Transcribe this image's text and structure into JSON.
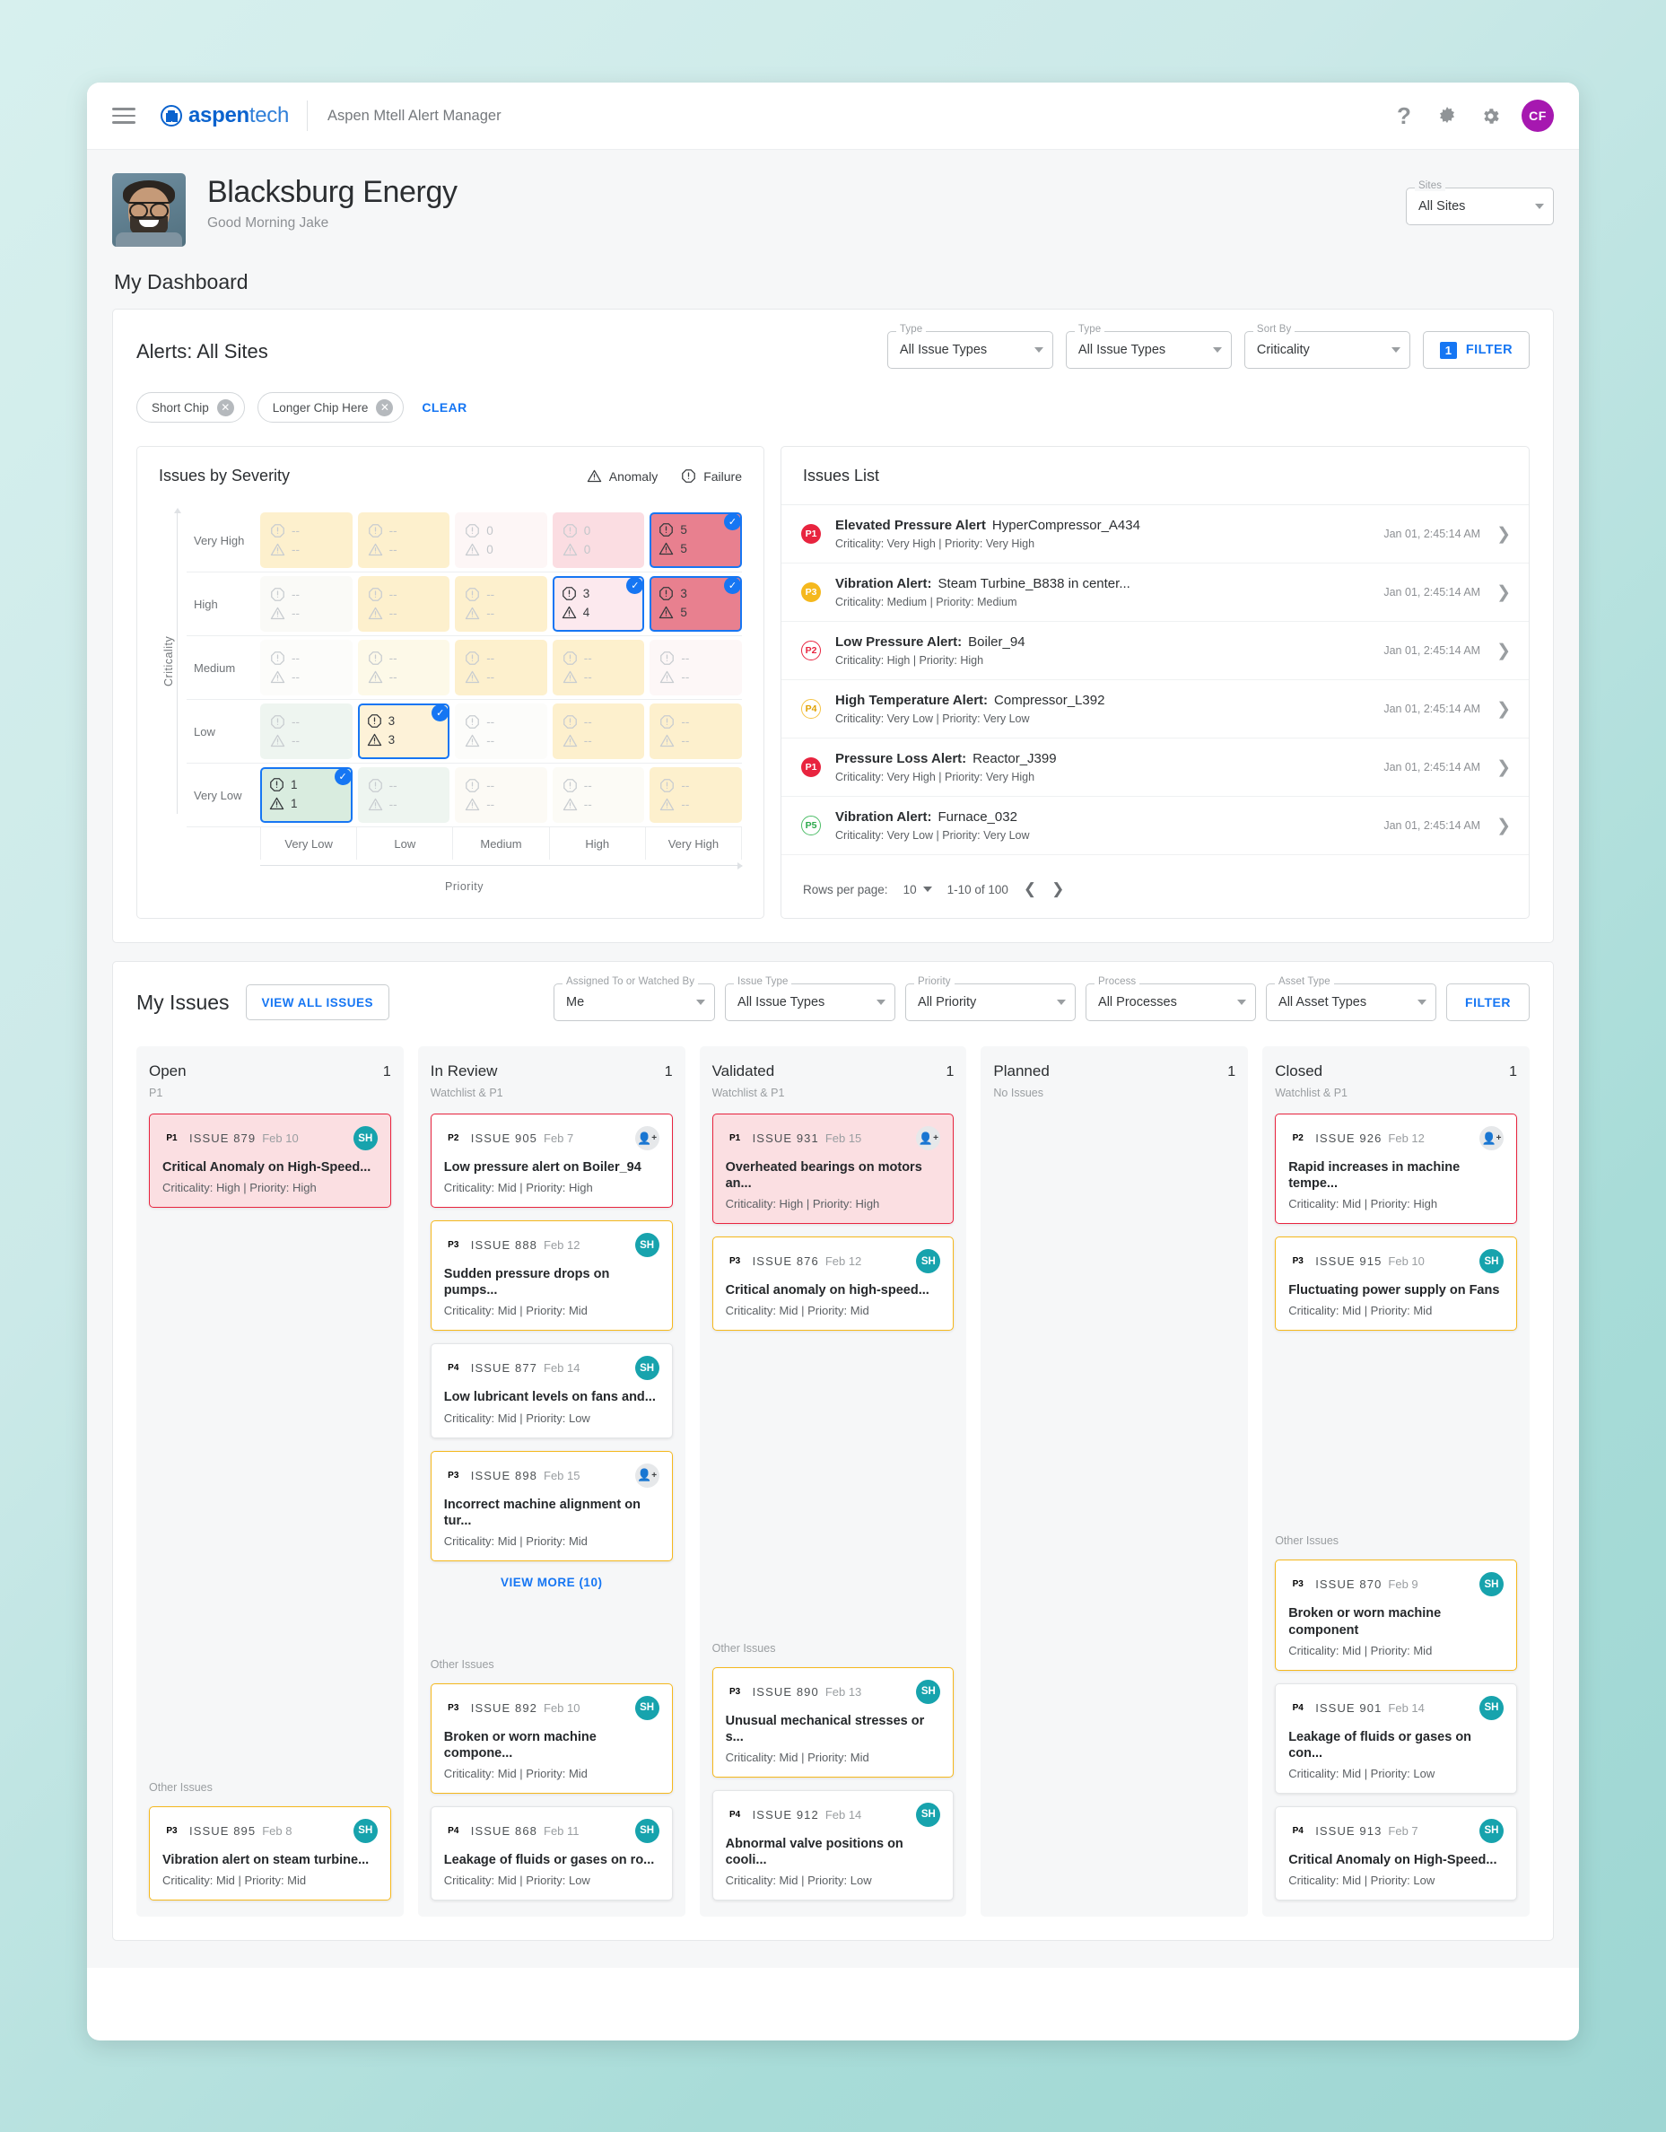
{
  "topbar": {
    "menu_icon": "hamburger-icon",
    "brand_primary": "aspen",
    "brand_secondary": "tech",
    "app_title": "Aspen Mtell Alert Manager",
    "help_icon": "question-mark-icon",
    "theme_icon": "dark-mode-icon",
    "settings_icon": "gear-icon",
    "avatar_initials": "CF"
  },
  "hero": {
    "title": "Blacksburg Energy",
    "greeting": "Good Morning Jake",
    "sites_label": "Sites",
    "sites_value": "All Sites"
  },
  "dashboard": {
    "title": "My Dashboard"
  },
  "alerts": {
    "title": "Alerts: All Sites",
    "controls": [
      {
        "label": "Type",
        "value": "All Issue Types"
      },
      {
        "label": "Type",
        "value": "All Issue Types"
      },
      {
        "label": "Sort By",
        "value": "Criticality"
      }
    ],
    "filter_count": "1",
    "filter_label": "FILTER",
    "chips": [
      "Short Chip",
      "Longer Chip Here"
    ],
    "clear_label": "CLEAR"
  },
  "chart_data": {
    "type": "heatmap",
    "title": "Issues by Severity",
    "xlabel": "Priority",
    "ylabel": "Criticality",
    "legend": [
      {
        "name": "Anomaly",
        "icon": "triangle-warning-icon"
      },
      {
        "name": "Failure",
        "icon": "octagon-exclamation-icon"
      }
    ],
    "x_categories": [
      "Very Low",
      "Low",
      "Medium",
      "High",
      "Very High"
    ],
    "y_categories": [
      "Very High",
      "High",
      "Medium",
      "Low",
      "Very Low"
    ],
    "cells": [
      [
        {
          "failure": "--",
          "anomaly": "--",
          "fill": "#fdf0cd",
          "dim": true,
          "selected": false
        },
        {
          "failure": "--",
          "anomaly": "--",
          "fill": "#fdf0cd",
          "dim": true,
          "selected": false
        },
        {
          "failure": "0",
          "anomaly": "0",
          "fill": "#fdf6f6",
          "dim": true,
          "selected": false
        },
        {
          "failure": "0",
          "anomaly": "0",
          "fill": "#fbdde2",
          "dim": true,
          "selected": false
        },
        {
          "failure": "5",
          "anomaly": "5",
          "fill": "#e8808f",
          "dim": false,
          "selected": true
        }
      ],
      [
        {
          "failure": "--",
          "anomaly": "--",
          "fill": "#fafaf7",
          "dim": true,
          "selected": false
        },
        {
          "failure": "--",
          "anomaly": "--",
          "fill": "#fdf0cd",
          "dim": true,
          "selected": false
        },
        {
          "failure": "--",
          "anomaly": "--",
          "fill": "#fdf0cd",
          "dim": true,
          "selected": false
        },
        {
          "failure": "3",
          "anomaly": "4",
          "fill": "#fce9ee",
          "dim": false,
          "selected": true
        },
        {
          "failure": "3",
          "anomaly": "5",
          "fill": "#e8808f",
          "dim": false,
          "selected": true
        }
      ],
      [
        {
          "failure": "--",
          "anomaly": "--",
          "fill": "#fcfcfa",
          "dim": true,
          "selected": false
        },
        {
          "failure": "--",
          "anomaly": "--",
          "fill": "#fdf9e8",
          "dim": true,
          "selected": false
        },
        {
          "failure": "--",
          "anomaly": "--",
          "fill": "#fdf0cd",
          "dim": true,
          "selected": false
        },
        {
          "failure": "--",
          "anomaly": "--",
          "fill": "#fdf0cd",
          "dim": true,
          "selected": false
        },
        {
          "failure": "--",
          "anomaly": "--",
          "fill": "#fdf7f7",
          "dim": true,
          "selected": false
        }
      ],
      [
        {
          "failure": "--",
          "anomaly": "--",
          "fill": "#eef5f0",
          "dim": true,
          "selected": false
        },
        {
          "failure": "3",
          "anomaly": "3",
          "fill": "#fdf2d8",
          "dim": false,
          "selected": true
        },
        {
          "failure": "--",
          "anomaly": "--",
          "fill": "#fcfcfa",
          "dim": true,
          "selected": false
        },
        {
          "failure": "--",
          "anomaly": "--",
          "fill": "#fdf0cd",
          "dim": true,
          "selected": false
        },
        {
          "failure": "--",
          "anomaly": "--",
          "fill": "#fdf0cd",
          "dim": true,
          "selected": false
        }
      ],
      [
        {
          "failure": "1",
          "anomaly": "1",
          "fill": "#d9ecdf",
          "dim": false,
          "selected": true
        },
        {
          "failure": "--",
          "anomaly": "--",
          "fill": "#eef5f0",
          "dim": true,
          "selected": false
        },
        {
          "failure": "--",
          "anomaly": "--",
          "fill": "#fcfaf5",
          "dim": true,
          "selected": false
        },
        {
          "failure": "--",
          "anomaly": "--",
          "fill": "#fcfbf6",
          "dim": true,
          "selected": false
        },
        {
          "failure": "--",
          "anomaly": "--",
          "fill": "#fdf0cd",
          "dim": true,
          "selected": false
        }
      ]
    ]
  },
  "issues_list": {
    "title": "Issues List",
    "rows": [
      {
        "priority": "P1",
        "ptype": "p1",
        "title": "Elevated Pressure Alert",
        "asset": "HyperCompressor_A434",
        "meta": "Criticality: Very High |  Priority: Very High",
        "date": "Jan 01, 2:45:14 AM"
      },
      {
        "priority": "P3",
        "ptype": "p3",
        "title": "Vibration Alert:",
        "asset": "Steam Turbine_B838 in center...",
        "meta": "Criticality: Medium |  Priority: Medium",
        "date": "Jan 01, 2:45:14 AM"
      },
      {
        "priority": "P2",
        "ptype": "p2",
        "title": "Low Pressure Alert:",
        "asset": "Boiler_94",
        "meta": "Criticality: High |  Priority: High",
        "date": "Jan 01, 2:45:14 AM"
      },
      {
        "priority": "P4",
        "ptype": "p4",
        "title": "High Temperature Alert:",
        "asset": "Compressor_L392",
        "meta": "Criticality: Very Low |  Priority: Very Low",
        "date": "Jan 01, 2:45:14 AM"
      },
      {
        "priority": "P1",
        "ptype": "p1",
        "title": "Pressure Loss Alert:",
        "asset": "Reactor_J399",
        "meta": "Criticality: Very High |  Priority: Very High",
        "date": "Jan 01, 2:45:14 AM"
      },
      {
        "priority": "P5",
        "ptype": "p5",
        "title": "Vibration Alert:",
        "asset": "Furnace_032",
        "meta": "Criticality: Very Low |  Priority: Very Low",
        "date": "Jan 01, 2:45:14 AM"
      }
    ],
    "rows_per_page_label": "Rows per page:",
    "rows_per_page_value": "10",
    "range": "1-10 of 100",
    "prev_icon": "chevron-left-icon",
    "next_icon": "chevron-right-icon"
  },
  "my_issues": {
    "title": "My Issues",
    "view_all_label": "VIEW ALL ISSUES",
    "filters": [
      {
        "label": "Assigned To or Watched By",
        "value": "Me"
      },
      {
        "label": "Issue Type",
        "value": "All Issue Types"
      },
      {
        "label": "Priority",
        "value": "All Priority"
      },
      {
        "label": "Process",
        "value": "All Processes"
      },
      {
        "label": "Asset Type",
        "value": "All Asset Types"
      }
    ],
    "filter_label": "FILTER",
    "other_issues_label": "Other Issues",
    "view_more_label": "VIEW MORE (10)",
    "columns": [
      {
        "name": "Open",
        "count": "1",
        "subtitle": "P1",
        "cards": [
          {
            "priority": "P1",
            "ptype": "p1",
            "id": "ISSUE 879",
            "date": "Feb 10",
            "title": "Critical Anomaly on High-Speed...",
            "meta": "Criticality: High |  Priority: High",
            "avatar": "SH",
            "avatar_type": "initials",
            "style": "bd-red bg-red"
          }
        ],
        "other": [
          {
            "priority": "P3",
            "ptype": "p3",
            "id": "ISSUE 895",
            "date": "Feb 8",
            "title": "Vibration alert on steam turbine...",
            "meta": "Criticality: Mid |  Priority: Mid",
            "avatar": "SH",
            "avatar_type": "initials",
            "style": "bd-yellow"
          }
        ]
      },
      {
        "name": "In Review",
        "count": "1",
        "subtitle": "Watchlist & P1",
        "cards": [
          {
            "priority": "P2",
            "ptype": "p2",
            "id": "ISSUE 905",
            "date": "Feb 7",
            "title": "Low pressure alert on Boiler_94",
            "meta": "Criticality: Mid |  Priority: High",
            "avatar": "add-person-icon",
            "avatar_type": "add",
            "style": "bd-red"
          },
          {
            "priority": "P3",
            "ptype": "p3",
            "id": "ISSUE 888",
            "date": "Feb 12",
            "title": "Sudden pressure drops on pumps...",
            "meta": "Criticality: Mid |  Priority: Mid",
            "avatar": "SH",
            "avatar_type": "initials",
            "style": "bd-yellow"
          },
          {
            "priority": "P4",
            "ptype": "p4",
            "id": "ISSUE 877",
            "date": "Feb 14",
            "title": "Low lubricant levels on fans and...",
            "meta": "Criticality: Mid |  Priority: Low",
            "avatar": "SH",
            "avatar_type": "initials",
            "style": ""
          },
          {
            "priority": "P3",
            "ptype": "p3",
            "id": "ISSUE 898",
            "date": "Feb 15",
            "title": "Incorrect machine alignment on tur...",
            "meta": "Criticality: Mid |  Priority: Mid",
            "avatar": "add-person-icon",
            "avatar_type": "add",
            "style": "bd-yellow"
          }
        ],
        "has_view_more": true,
        "other": [
          {
            "priority": "P3",
            "ptype": "p3",
            "id": "ISSUE 892",
            "date": "Feb 10",
            "title": "Broken or worn machine compone...",
            "meta": "Criticality: Mid |  Priority: Mid",
            "avatar": "SH",
            "avatar_type": "initials",
            "style": "bd-yellow"
          },
          {
            "priority": "P4",
            "ptype": "p4",
            "id": "ISSUE 868",
            "date": "Feb 11",
            "title": "Leakage of fluids or gases on ro...",
            "meta": "Criticality: Mid |  Priority: Low",
            "avatar": "SH",
            "avatar_type": "initials",
            "style": ""
          }
        ]
      },
      {
        "name": "Validated",
        "count": "1",
        "subtitle": "Watchlist & P1",
        "cards": [
          {
            "priority": "P1",
            "ptype": "p1",
            "id": "ISSUE 931",
            "date": "Feb 15",
            "title": "Overheated bearings on motors an...",
            "meta": "Criticality: High |  Priority: High",
            "avatar": "add-person-icon",
            "avatar_type": "add",
            "style": "bd-red bg-red"
          },
          {
            "priority": "P3",
            "ptype": "p3",
            "id": "ISSUE 876",
            "date": "Feb 12",
            "title": "Critical anomaly on high-speed...",
            "meta": "Criticality: Mid |  Priority: Mid",
            "avatar": "SH",
            "avatar_type": "initials",
            "style": "bd-yellow"
          }
        ],
        "other": [
          {
            "priority": "P3",
            "ptype": "p3",
            "id": "ISSUE 890",
            "date": "Feb 13",
            "title": "Unusual mechanical stresses or s...",
            "meta": "Criticality: Mid |  Priority: Mid",
            "avatar": "SH",
            "avatar_type": "initials",
            "style": "bd-yellow"
          },
          {
            "priority": "P4",
            "ptype": "p4",
            "id": "ISSUE 912",
            "date": "Feb 14",
            "title": "Abnormal valve positions on cooli...",
            "meta": "Criticality: Mid |  Priority: Low",
            "avatar": "SH",
            "avatar_type": "initials",
            "style": ""
          }
        ]
      },
      {
        "name": "Planned",
        "count": "1",
        "subtitle": "No Issues",
        "cards": [],
        "other": []
      },
      {
        "name": "Closed",
        "count": "1",
        "subtitle": "Watchlist & P1",
        "cards": [
          {
            "priority": "P2",
            "ptype": "p2",
            "id": "ISSUE 926",
            "date": "Feb 12",
            "title": "Rapid increases in machine tempe...",
            "meta": "Criticality: Mid |  Priority: High",
            "avatar": "add-person-icon",
            "avatar_type": "add",
            "style": "bd-red"
          },
          {
            "priority": "P3",
            "ptype": "p3",
            "id": "ISSUE 915",
            "date": "Feb 10",
            "title": "Fluctuating power supply on Fans",
            "meta": "Criticality: Mid |  Priority: Mid",
            "avatar": "SH",
            "avatar_type": "initials",
            "style": "bd-yellow"
          }
        ],
        "other": [
          {
            "priority": "P3",
            "ptype": "p3",
            "id": "ISSUE 870",
            "date": "Feb 9",
            "title": "Broken or worn machine component",
            "meta": "Criticality: Mid |  Priority: Mid",
            "avatar": "SH",
            "avatar_type": "initials",
            "style": "bd-yellow"
          },
          {
            "priority": "P4",
            "ptype": "p4",
            "id": "ISSUE 901",
            "date": "Feb 14",
            "title": "Leakage of fluids or gases on con...",
            "meta": "Criticality: Mid |  Priority: Low",
            "avatar": "SH",
            "avatar_type": "initials",
            "style": ""
          },
          {
            "priority": "P4",
            "ptype": "p4",
            "id": "ISSUE 913",
            "date": "Feb 7",
            "title": "Critical Anomaly on High-Speed...",
            "meta": "Criticality: Mid |  Priority: Low",
            "avatar": "SH",
            "avatar_type": "initials",
            "style": ""
          }
        ]
      }
    ]
  }
}
